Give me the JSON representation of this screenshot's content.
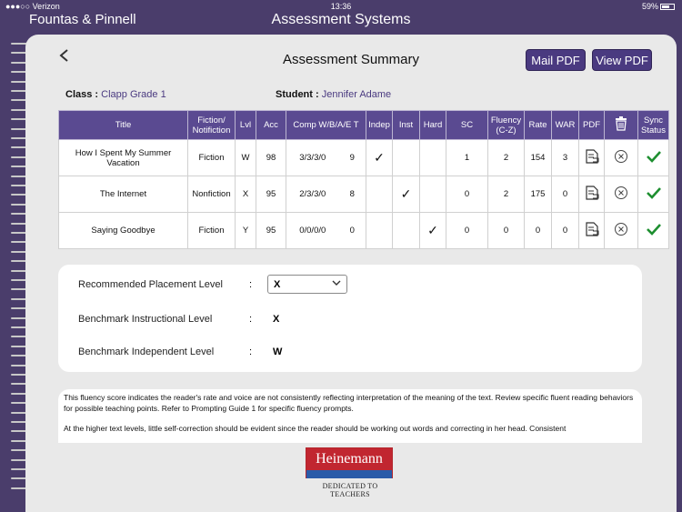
{
  "status_bar": {
    "carrier": "●●●○○ Verizon",
    "time": "13:36",
    "battery": "59%"
  },
  "header": {
    "app_name": "Fountas & Pinnell",
    "app_title": "Assessment Systems"
  },
  "page": {
    "title": "Assessment Summary",
    "mail_pdf_label": "Mail PDF",
    "view_pdf_label": "View PDF",
    "class_label": "Class :",
    "class_value": "Clapp Grade 1",
    "student_label": "Student :",
    "student_value": "Jennifer Adame"
  },
  "table": {
    "headers": {
      "title": "Title",
      "fiction": "Fiction/ Notifiction",
      "lvl": "Lvl",
      "acc": "Acc",
      "comp": "Comp W/B/A/E T",
      "indep": "Indep",
      "inst": "Inst",
      "hard": "Hard",
      "sc": "SC",
      "fluency": "Fluency (C-Z)",
      "rate": "Rate",
      "war": "WAR",
      "pdf": "PDF",
      "sync": "Sync Status"
    },
    "rows": [
      {
        "title": "How I Spent My Summer Vacation",
        "fiction": "Fiction",
        "lvl": "W",
        "acc": "98",
        "comp": "3/3/3/0",
        "comp_t": "9",
        "indep": "✓",
        "inst": "",
        "hard": "",
        "sc": "1",
        "fluency": "2",
        "rate": "154",
        "war": "3"
      },
      {
        "title": "The Internet",
        "fiction": "Nonfiction",
        "lvl": "X",
        "acc": "95",
        "comp": "2/3/3/0",
        "comp_t": "8",
        "indep": "",
        "inst": "✓",
        "hard": "",
        "sc": "0",
        "fluency": "2",
        "rate": "175",
        "war": "0"
      },
      {
        "title": "Saying Goodbye",
        "fiction": "Fiction",
        "lvl": "Y",
        "acc": "95",
        "comp": "0/0/0/0",
        "comp_t": "0",
        "indep": "",
        "inst": "",
        "hard": "✓",
        "sc": "0",
        "fluency": "0",
        "rate": "0",
        "war": "0"
      }
    ]
  },
  "placement": {
    "recommended_label": "Recommended Placement Level",
    "recommended_value": "X",
    "instructional_label": "Benchmark Instructional Level",
    "instructional_value": "X",
    "independent_label": "Benchmark Independent Level",
    "independent_value": "W",
    "colon": ":"
  },
  "notes": {
    "p1": "This fluency score indicates the reader's rate and voice are not consistently reflecting interpretation of the meaning of the text.  Review specific fluent reading behaviors for possible teaching points.  Refer to Prompting Guide 1 for specific fluency prompts.",
    "p2": "At the higher text levels, little self-correction should be evident since the reader should be working out words and correcting in her head. Consistent"
  },
  "logo": {
    "name": "Heinemann",
    "tagline": "DEDICATED TO TEACHERS"
  },
  "colors": {
    "purple": "#4a3a80",
    "header_purple": "#5a4a91",
    "sync_green": "#1e8f30"
  },
  "icons": {
    "pdf": "document-icon",
    "delete": "trash-icon",
    "remove": "circle-x-icon",
    "sync": "checkmark-icon"
  }
}
